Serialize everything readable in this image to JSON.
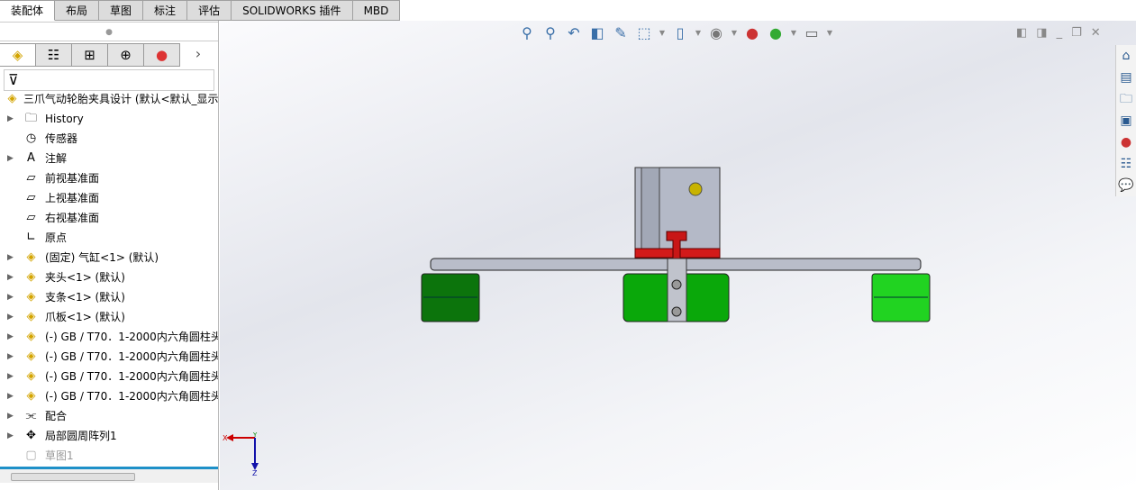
{
  "tabs": [
    "装配体",
    "布局",
    "草图",
    "标注",
    "评估",
    "SOLIDWORKS 插件",
    "MBD"
  ],
  "panel_tabs": [
    "feature-manager",
    "property-manager",
    "configuration-manager",
    "dimxpert-manager",
    "display-manager"
  ],
  "tree": {
    "root": "三爪气动轮胎夹具设计  (默认<默认_显示",
    "items": [
      {
        "label": "History",
        "arrow": true,
        "icon": "history-folder-icon"
      },
      {
        "label": "传感器",
        "arrow": false,
        "icon": "sensor-icon"
      },
      {
        "label": "注解",
        "arrow": true,
        "icon": "annotation-icon"
      },
      {
        "label": "前视基准面",
        "arrow": false,
        "icon": "plane-icon"
      },
      {
        "label": "上视基准面",
        "arrow": false,
        "icon": "plane-icon"
      },
      {
        "label": "右视基准面",
        "arrow": false,
        "icon": "plane-icon"
      },
      {
        "label": "原点",
        "arrow": false,
        "icon": "origin-icon"
      },
      {
        "label": "(固定) 气缸<1> (默认)",
        "arrow": true,
        "icon": "part-icon"
      },
      {
        "label": "夹头<1> (默认)",
        "arrow": true,
        "icon": "part-icon"
      },
      {
        "label": "支条<1> (默认)",
        "arrow": true,
        "icon": "part-icon"
      },
      {
        "label": "爪板<1> (默认)",
        "arrow": true,
        "icon": "part-icon"
      },
      {
        "label": "(-) GB / T70．1-2000内六角圆柱头",
        "arrow": true,
        "icon": "part-icon"
      },
      {
        "label": "(-) GB / T70．1-2000内六角圆柱头",
        "arrow": true,
        "icon": "part-icon"
      },
      {
        "label": "(-) GB / T70．1-2000内六角圆柱头",
        "arrow": true,
        "icon": "part-icon"
      },
      {
        "label": "(-) GB / T70．1-2000内六角圆柱头",
        "arrow": true,
        "icon": "part-icon"
      },
      {
        "label": "配合",
        "arrow": true,
        "icon": "mates-icon"
      },
      {
        "label": "局部圆周阵列1",
        "arrow": true,
        "icon": "pattern-icon"
      },
      {
        "label": "草图1",
        "arrow": false,
        "icon": "sketch-icon"
      }
    ]
  },
  "triad": {
    "x": "X",
    "y": "Y",
    "z": "Z"
  }
}
